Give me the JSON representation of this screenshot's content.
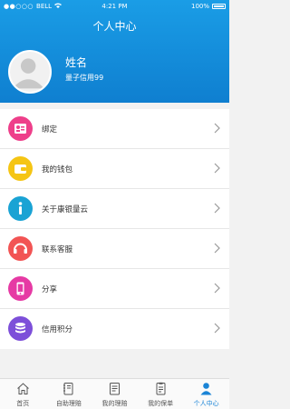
{
  "status": {
    "carrier": "BELL",
    "time": "4:21 PM",
    "battery": "100%"
  },
  "header": {
    "title": "个人中心"
  },
  "profile": {
    "name": "姓名",
    "credit": "量子信用99"
  },
  "menu": [
    {
      "label": "绑定",
      "icon": "bind-icon",
      "color": "#ee3f8a"
    },
    {
      "label": "我的钱包",
      "icon": "wallet-icon",
      "color": "#f5c514"
    },
    {
      "label": "关于康银量云",
      "icon": "info-icon",
      "color": "#1aa3d4"
    },
    {
      "label": "联系客服",
      "icon": "headset-icon",
      "color": "#f25454"
    },
    {
      "label": "分享",
      "icon": "phone-icon",
      "color": "#e63aa4"
    },
    {
      "label": "信用积分",
      "icon": "coins-icon",
      "color": "#7d4fd9"
    }
  ],
  "tabs": [
    {
      "label": "首页",
      "icon": "home-icon"
    },
    {
      "label": "自助理赔",
      "icon": "notebook-icon"
    },
    {
      "label": "我的理赔",
      "icon": "document-icon"
    },
    {
      "label": "我的保单",
      "icon": "policy-icon"
    },
    {
      "label": "个人中心",
      "icon": "user-icon",
      "active": true
    }
  ]
}
